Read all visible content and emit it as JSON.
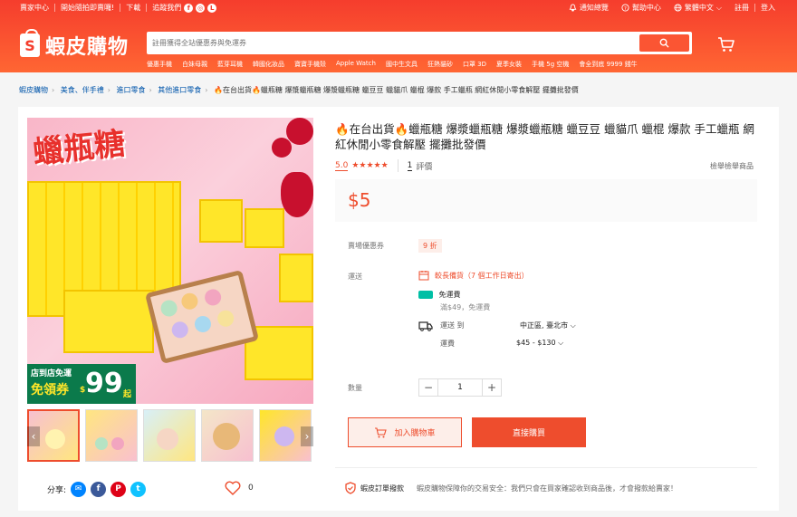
{
  "topbar": {
    "links": [
      "賣家中心",
      "開始隨拍即賣囉!",
      "下載",
      "追蹤我們"
    ],
    "social_icons": [
      "facebook-icon",
      "instagram-icon",
      "line-icon"
    ],
    "notifications": "通知總覽",
    "help": "幫助中心",
    "language": "繁體中文",
    "register": "註冊",
    "login": "登入"
  },
  "header": {
    "logo_text": "蝦皮購物",
    "search_placeholder": "註冊獲得全站優惠券與免運券",
    "suggestions": [
      "優惠手機",
      "白妹母親",
      "藍芽耳機",
      "韓國化妝品",
      "寶寶手機殼",
      "Apple Watch",
      "國中生文具",
      "狂熱貓砂",
      "口罩 3D",
      "夏季女裝",
      "手機 5g 空機",
      "會全到底 9999 錢牛"
    ]
  },
  "breadcrumb": [
    "蝦皮購物",
    "美食、伴手禮",
    "進口零食",
    "其他進口零食",
    "🔥在台出貨🔥蠟瓶糖 爆漿蠟瓶糖 爆漿蠟瓶糖 蠟豆豆 蠟貓爪 蠟棍 爆款 手工蠟瓶 網紅休閒小零食解壓 擺攤批發價"
  ],
  "gallery": {
    "art_title": "蠟瓶糖",
    "voucher_line1": "店到店免運",
    "voucher_line2": "免領券",
    "voucher_currency": "$",
    "voucher_amount": "99",
    "voucher_suffix": "起"
  },
  "share": {
    "label": "分享:",
    "likes": "0"
  },
  "product": {
    "title": "🔥在台出貨🔥蠟瓶糖 爆漿蠟瓶糖 爆漿蠟瓶糖 蠟豆豆 蠟貓爪 蠟棍 爆款 手工蠟瓶 網紅休閒小零食解壓 擺攤批發價",
    "rating": "5.0",
    "stars": "★★★★★",
    "review_count": "1",
    "review_label": "評價",
    "report": "檢舉檢舉商品",
    "price": "$5",
    "voucher_label": "賣場優惠券",
    "voucher_badge": "9 折",
    "shipping_label": "運送",
    "shipping_note": "較長備貨（7 個工作日寄出）",
    "free_shipping": "免運費",
    "free_shipping_sub": "滿$49，免運費",
    "ship_to_label": "運送 到",
    "ship_to_value": "中正區, 臺北市",
    "shipping_fee_label": "運費",
    "shipping_fee_value": "$45 - $130",
    "quantity_label": "數量",
    "quantity": "1",
    "add_to_cart": "加入購物車",
    "buy_now": "直接購買",
    "guarantee_title": "蝦皮訂單撥款",
    "guarantee_desc": "蝦皮購物保障你的交易安全：我們只會在買家確認收到商品後，才會撥款給賣家！"
  },
  "colors": {
    "brand": "#ee4d2d",
    "header": "#f53d2d"
  }
}
